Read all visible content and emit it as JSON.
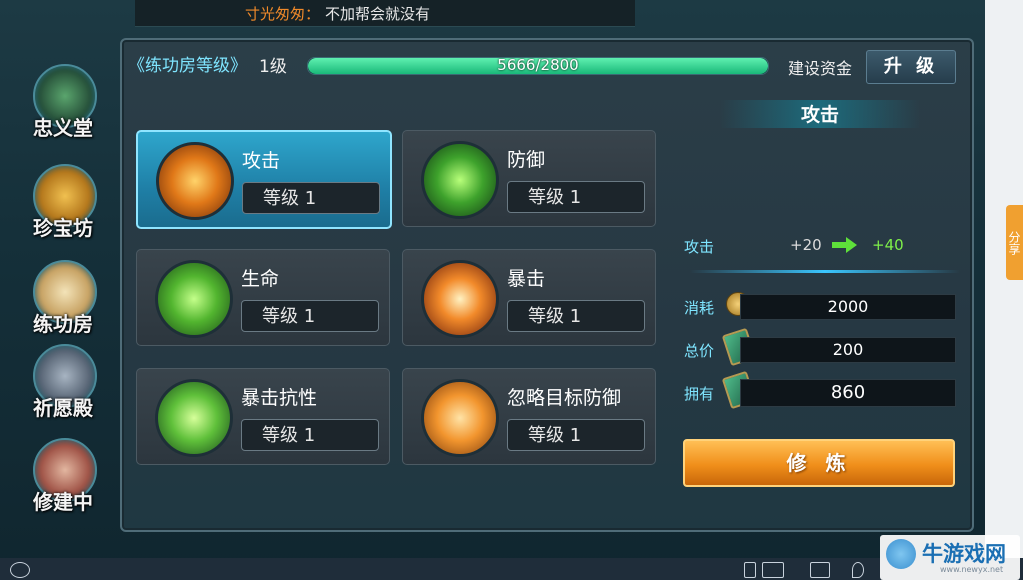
{
  "chat": {
    "name": "寸光匆匆：",
    "message": "不加帮会就没有"
  },
  "share": {
    "label": "分享"
  },
  "nav": [
    {
      "label": "忠义堂",
      "icon": "loyalty-hall-icon"
    },
    {
      "label": "珍宝坊",
      "icon": "treasure-bag-icon"
    },
    {
      "label": "练功房",
      "icon": "training-scroll-icon"
    },
    {
      "label": "祈愿殿",
      "icon": "demon-mask-icon"
    },
    {
      "label": "修建中",
      "icon": "construction-axe-icon"
    }
  ],
  "header": {
    "rank_label": "《练功房等级》",
    "level": "1级",
    "progress_text": "5666/2800",
    "progress_fraction": 1.0,
    "fund_label": "建设资金",
    "upgrade_label": "升 级"
  },
  "cards": [
    {
      "name": "攻击",
      "level": "等级   1",
      "icon": "sword-fire-icon",
      "selected": true
    },
    {
      "name": "防御",
      "level": "等级   1",
      "icon": "shield-green-icon",
      "selected": false
    },
    {
      "name": "生命",
      "level": "等级   1",
      "icon": "life-tree-icon",
      "selected": false
    },
    {
      "name": "暴击",
      "level": "等级   1",
      "icon": "critical-burst-icon",
      "selected": false
    },
    {
      "name": "暴击抗性",
      "level": "等级   1",
      "icon": "crit-resist-icon",
      "selected": false
    },
    {
      "name": "忽略目标防御",
      "level": "等级   1",
      "icon": "ignore-defense-icon",
      "selected": false
    }
  ],
  "detail": {
    "title": "攻击",
    "stat_label": "攻击",
    "stat_old": "+20",
    "stat_new": "+40",
    "consume_label": "消耗",
    "consume_value": "2000",
    "total_label": "总价",
    "total_value": "200",
    "own_label": "拥有",
    "own_value": "860",
    "train_label": "修 炼"
  },
  "watermark": {
    "text": "牛游戏网",
    "url": "www.newyx.net"
  },
  "colors": {
    "accent": "#7fe5ff",
    "progress": "#1ab879",
    "train_button": "#f08f1a",
    "gain": "#7ff04a"
  }
}
